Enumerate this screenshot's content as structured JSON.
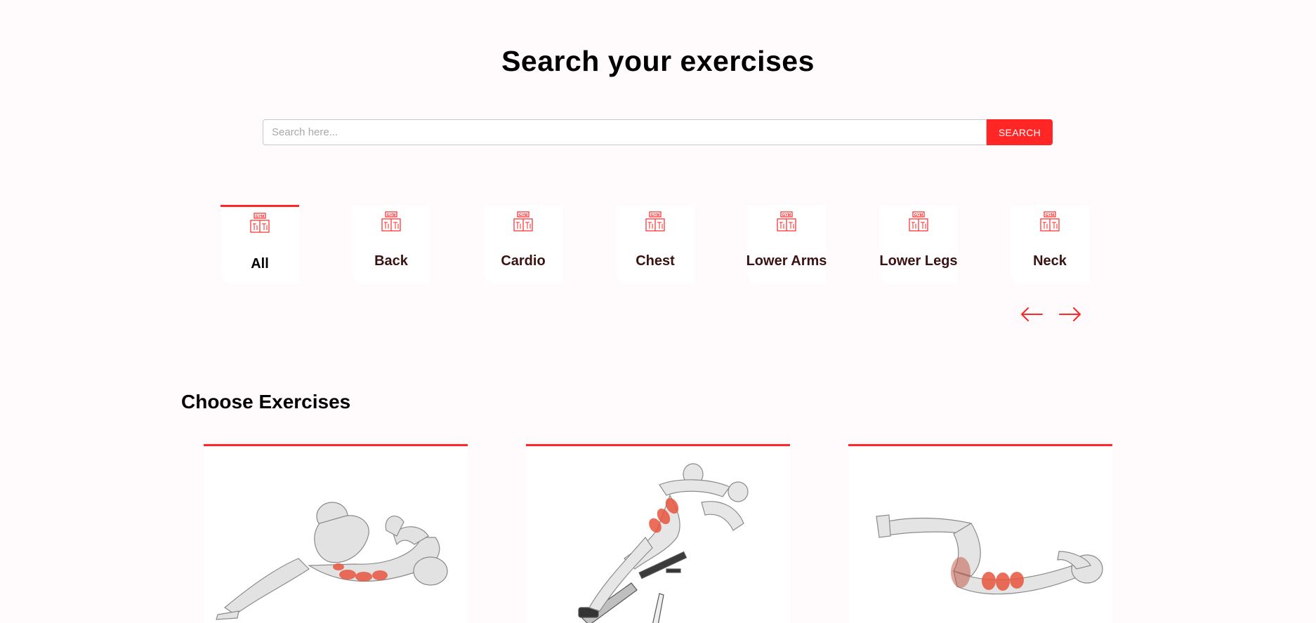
{
  "page": {
    "title": "Search your exercises"
  },
  "search": {
    "placeholder": "Search here...",
    "value": "",
    "button_label": "SEARCH"
  },
  "categories": [
    {
      "label": "All",
      "icon": "gym-icon",
      "active": true
    },
    {
      "label": "Back",
      "icon": "gym-icon",
      "active": false
    },
    {
      "label": "Cardio",
      "icon": "gym-icon",
      "active": false
    },
    {
      "label": "Chest",
      "icon": "gym-icon",
      "active": false
    },
    {
      "label": "Lower Arms",
      "icon": "gym-icon",
      "active": false
    },
    {
      "label": "Lower Legs",
      "icon": "gym-icon",
      "active": false
    },
    {
      "label": "Neck",
      "icon": "gym-icon",
      "active": false
    }
  ],
  "carousel": {
    "prev_icon": "arrow-left-icon",
    "next_icon": "arrow-right-icon"
  },
  "exercises_section": {
    "title": "Choose Exercises"
  },
  "exercise_cards": [
    {
      "image": "crossed-legs-crunch-illustration"
    },
    {
      "image": "decline-bench-sit-up-illustration"
    },
    {
      "image": "lying-leg-raise-crunch-illustration"
    }
  ],
  "colors": {
    "accent": "#ff2625",
    "background": "#fffafb",
    "card": "#ffffff",
    "label": "#3a1212"
  }
}
